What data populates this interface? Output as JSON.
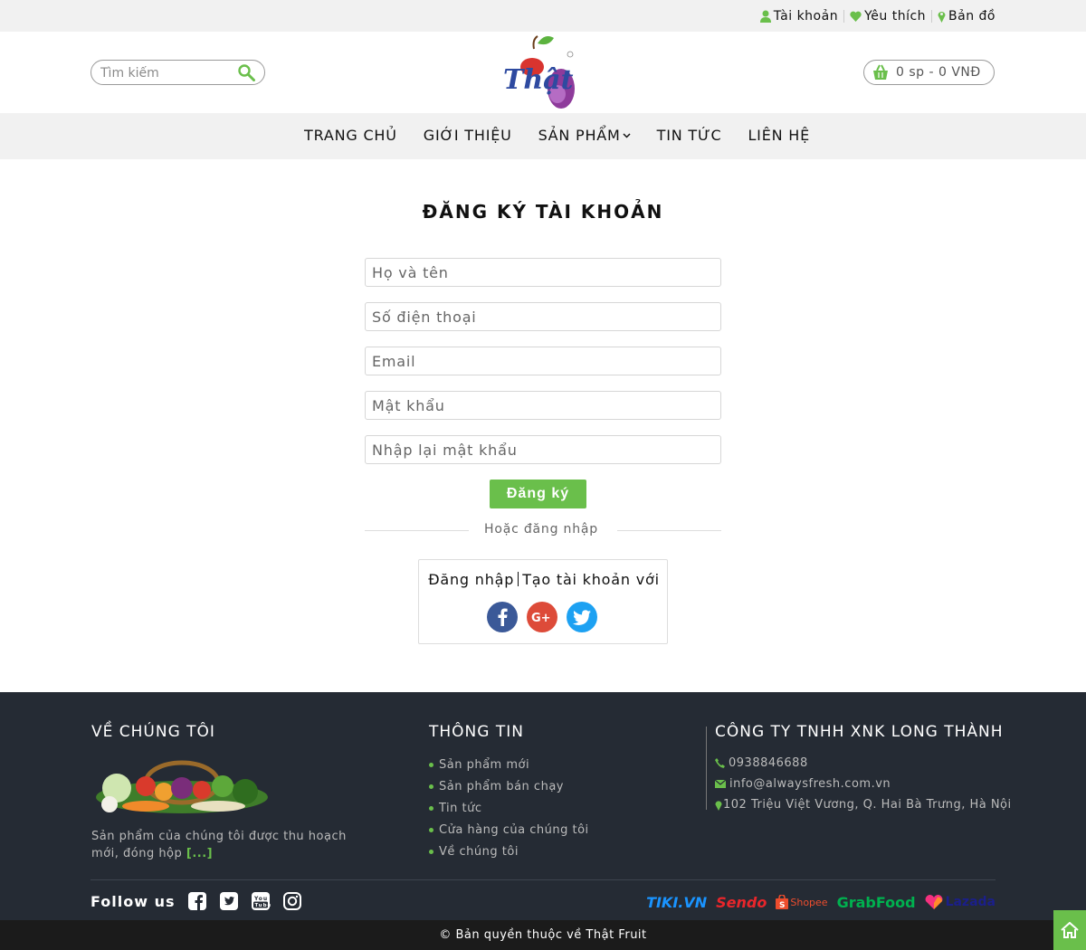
{
  "topbar": {
    "account": "Tài khoản",
    "favorites": "Yêu thích",
    "map": "Bản đồ"
  },
  "header": {
    "search_placeholder": "Tìm kiếm",
    "logo_text": "Thật",
    "cart": "0 sp - 0 VNĐ"
  },
  "nav": {
    "items": [
      {
        "label": "TRANG CHỦ"
      },
      {
        "label": "GIỚI THIỆU"
      },
      {
        "label": "SẢN PHẨM"
      },
      {
        "label": "TIN TỨC"
      },
      {
        "label": "LIÊN HỆ"
      }
    ]
  },
  "form": {
    "title": "ĐĂNG KÝ TÀI KHOẢN",
    "fullname_placeholder": "Họ và tên",
    "phone_placeholder": "Số điện thoại",
    "email_placeholder": "Email",
    "password_placeholder": "Mật khẩu",
    "confirm_placeholder": "Nhập lại mật khẩu",
    "submit": "Đăng ký",
    "or_login": "Hoặc đăng nhập",
    "social_login": "Đăng nhập",
    "social_create": "Tạo tài khoản với"
  },
  "footer": {
    "about_title": "VỀ CHÚNG TÔI",
    "about_text": "Sản phẩm của chúng tôi được thu hoạch mới, đóng hộp",
    "about_more": "[...]",
    "info_title": "THÔNG TIN",
    "info_links": [
      "Sản phẩm mới",
      "Sản phẩm bán chạy",
      "Tin tức",
      "Cửa hàng của chúng tôi",
      "Về chúng tôi"
    ],
    "company_title": "CÔNG TY TNHH XNK LONG THÀNH",
    "phone": "0938846688",
    "email": "info@alwaysfresh.com.vn",
    "address": "102 Triệu Việt Vương, Q. Hai Bà Trưng, Hà Nội",
    "follow": "Follow us",
    "partners": [
      "TIKI.VN",
      "Sendo",
      "Shopee",
      "GrabFood",
      "Lazada"
    ],
    "copyright": "© Bản quyền thuộc về Thật Fruit"
  },
  "colors": {
    "accent": "#6abf4b",
    "footer_bg": "#252b34",
    "bar_bg": "#f1f1f1"
  }
}
